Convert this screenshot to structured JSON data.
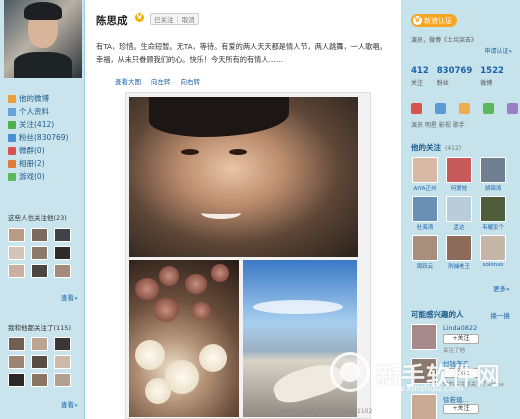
{
  "profile": {
    "name": "陈思成",
    "follow_status": "已关注",
    "cancel_label": "取消"
  },
  "sidebar": {
    "items": [
      {
        "label": "他的微博",
        "icon": "home-icon",
        "color": "#e8a13a"
      },
      {
        "label": "个人资料",
        "icon": "profile-icon",
        "color": "#6aa0d8"
      },
      {
        "label": "关注(412)",
        "icon": "follow-icon",
        "color": "#4fb04f"
      },
      {
        "label": "粉丝(830769)",
        "icon": "fans-icon",
        "color": "#4b8fd1"
      },
      {
        "label": "微群(0)",
        "icon": "group-icon",
        "color": "#d9534f"
      },
      {
        "label": "相册(2)",
        "icon": "album-icon",
        "color": "#e07b39"
      },
      {
        "label": "游戏(0)",
        "icon": "game-icon",
        "color": "#5cb85c"
      }
    ],
    "fans_title": "这些人也关注他(23)",
    "fans_more": "查看»",
    "common_title": "我和他都关注了(115)",
    "common_more": "查看»"
  },
  "post": {
    "text": "有TA，珍惜。生命短暂。无TA，等待。有爱的两人天天都是情人节，两人跳舞，一人歌唱。幸福，从未只眷顾我们的心。快乐！今天所有的有情人……",
    "tools": [
      "查看大图",
      "向左转",
      "向右转"
    ],
    "image_url_caption": "weibo.com/u/chensicheng1102"
  },
  "right": {
    "cert_label": "新浪认证",
    "bio": "演员，微博《士兵突击》",
    "apply_label": "申请认证»",
    "stats": [
      {
        "num": "412",
        "label": "关注"
      },
      {
        "num": "830769",
        "label": "粉丝"
      },
      {
        "num": "1522",
        "label": "微博"
      }
    ],
    "tags": "演员 明星 影视 歌手",
    "follows_title": "他的关注",
    "follows_count": "(412)",
    "follows": [
      {
        "name": "AIYA正州"
      },
      {
        "name": "何爱桂"
      },
      {
        "name": "胡锦涛"
      },
      {
        "name": "杜海涛"
      },
      {
        "name": "孟达"
      },
      {
        "name": "韦耀宏个"
      },
      {
        "name": "周跃云"
      },
      {
        "name": "刑捕老王"
      },
      {
        "name": "solonso"
      }
    ],
    "follows_more": "更多»",
    "maybe_title": "可能感兴趣的人",
    "swap_label": "换一换",
    "suggestions": [
      {
        "name": "Linda0822",
        "button": "+关注",
        "sub": "关注了他"
      },
      {
        "name": "付钱老王",
        "button": "+关注",
        "sub": "他的关注都关注了Selina"
      },
      {
        "name": "徐若瑄...",
        "button": "+关注",
        "sub": ""
      }
    ]
  },
  "watermark": {
    "site_name": "新手软件网",
    "site_url": "www.xinshou.com"
  }
}
